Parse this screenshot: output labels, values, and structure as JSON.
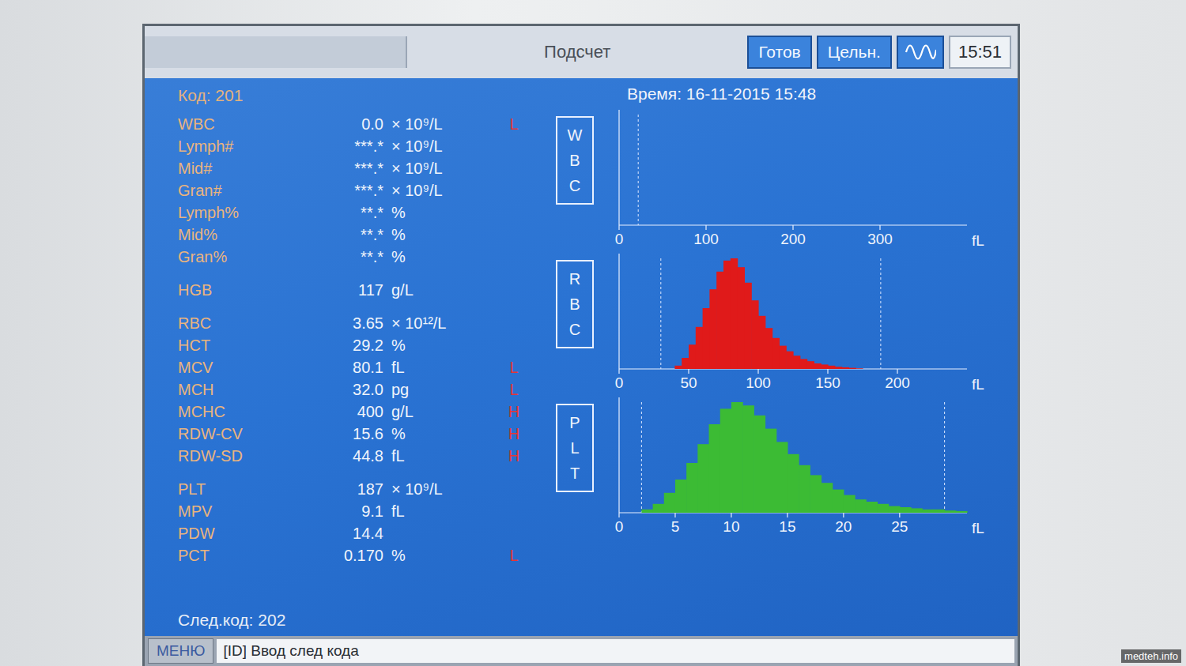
{
  "window": {
    "title": "Подсчет"
  },
  "toolbar": {
    "buttons": [
      {
        "label": "Готов",
        "selected": false
      },
      {
        "label": "Цельн.",
        "selected": false
      }
    ],
    "wave_button": {
      "selected": false
    },
    "clock": "15:51"
  },
  "sample": {
    "code": "Код: 201",
    "time": "Время: 16-11-2015 15:48",
    "next_code": "След.код: 202"
  },
  "parameter_groups": [
    {
      "rows": [
        {
          "name": "WBC",
          "value": "0.0",
          "unit": "× 10⁹/L",
          "flag": "L"
        },
        {
          "name": "Lymph#",
          "value": "***.*",
          "unit": "× 10⁹/L",
          "flag": ""
        },
        {
          "name": "Mid#",
          "value": "***.*",
          "unit": "× 10⁹/L",
          "flag": ""
        },
        {
          "name": "Gran#",
          "value": "***.*",
          "unit": "× 10⁹/L",
          "flag": ""
        },
        {
          "name": "Lymph%",
          "value": "**.*",
          "unit": "%",
          "flag": ""
        },
        {
          "name": "Mid%",
          "value": "**.*",
          "unit": "%",
          "flag": ""
        },
        {
          "name": "Gran%",
          "value": "**.*",
          "unit": "%",
          "flag": ""
        }
      ]
    },
    {
      "rows": [
        {
          "name": "HGB",
          "value": "117",
          "unit": "g/L",
          "flag": ""
        }
      ]
    },
    {
      "rows": [
        {
          "name": "RBC",
          "value": "3.65",
          "unit": "× 10¹²/L",
          "flag": ""
        },
        {
          "name": "HCT",
          "value": "29.2",
          "unit": "%",
          "flag": ""
        },
        {
          "name": "MCV",
          "value": "80.1",
          "unit": "fL",
          "flag": "L"
        },
        {
          "name": "MCH",
          "value": "32.0",
          "unit": "pg",
          "flag": "L"
        },
        {
          "name": "MCHC",
          "value": "400",
          "unit": "g/L",
          "flag": "H"
        },
        {
          "name": "RDW-CV",
          "value": "15.6",
          "unit": "%",
          "flag": "H"
        },
        {
          "name": "RDW-SD",
          "value": "44.8",
          "unit": "fL",
          "flag": "H"
        }
      ]
    },
    {
      "rows": [
        {
          "name": "PLT",
          "value": "187",
          "unit": "× 10⁹/L",
          "flag": ""
        },
        {
          "name": "MPV",
          "value": "9.1",
          "unit": "fL",
          "flag": ""
        },
        {
          "name": "PDW",
          "value": "14.4",
          "unit": "",
          "flag": ""
        },
        {
          "name": "PCT",
          "value": "0.170",
          "unit": "%",
          "flag": "L"
        }
      ]
    }
  ],
  "charts": [
    {
      "label": "WBC",
      "unit": "fL",
      "ticks": [
        "0",
        "100",
        "200",
        "300"
      ],
      "color": "#ffffff",
      "bin_width": 10,
      "markers": [
        22
      ],
      "values": [
        0,
        0,
        0,
        0,
        0,
        0,
        0,
        0,
        0,
        0,
        0,
        0,
        0,
        0,
        0,
        0,
        0,
        0,
        0,
        0,
        0,
        0,
        0,
        0,
        0,
        0,
        0,
        0,
        0,
        0,
        0,
        0,
        0,
        0,
        0,
        0,
        0,
        0,
        0,
        0
      ]
    },
    {
      "label": "RBC",
      "unit": "fL",
      "ticks": [
        "0",
        "50",
        "100",
        "150",
        "200"
      ],
      "color": "#e01a1a",
      "bin_width": 5,
      "markers": [
        30,
        188
      ],
      "values": [
        0,
        0,
        0,
        0,
        0,
        0,
        0,
        0,
        3,
        10,
        22,
        38,
        55,
        72,
        88,
        98,
        100,
        92,
        78,
        62,
        48,
        37,
        28,
        21,
        16,
        12,
        9,
        7,
        5,
        4,
        3,
        2,
        1.5,
        1,
        0.5,
        0,
        0,
        0,
        0,
        0,
        0,
        0,
        0,
        0,
        0,
        0,
        0,
        0,
        0,
        0
      ]
    },
    {
      "label": "PLT",
      "unit": "fL",
      "ticks": [
        "0",
        "5",
        "10",
        "15",
        "20",
        "25"
      ],
      "color": "#3cbb34",
      "bin_width": 1,
      "markers": [
        2,
        29
      ],
      "values": [
        0,
        0,
        3,
        8,
        18,
        30,
        45,
        62,
        80,
        94,
        100,
        97,
        88,
        76,
        64,
        53,
        43,
        34,
        27,
        21,
        16,
        12,
        10,
        8,
        6,
        5,
        4,
        3,
        3,
        2,
        1.5
      ]
    }
  ],
  "menu_bar": {
    "menu_button": "МЕНЮ",
    "prompt": "[ID] Ввод след кода"
  },
  "watermark": "medteh.info"
}
